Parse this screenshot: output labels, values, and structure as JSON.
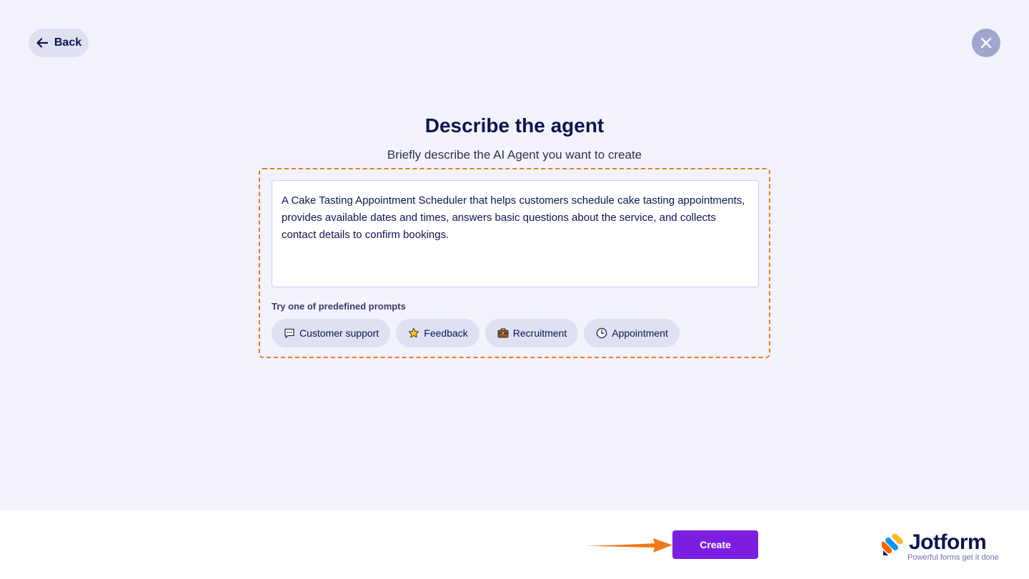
{
  "header": {
    "back_label": "Back",
    "back_icon": "arrow-left-icon",
    "close_icon": "close-icon"
  },
  "main": {
    "title": "Describe the agent",
    "subtitle": "Briefly describe the AI Agent you want to create",
    "description_value": "A Cake Tasting Appointment Scheduler that helps customers schedule cake tasting appointments, provides available dates and times, answers basic questions about the service, and collects contact details to confirm bookings.",
    "predefined_label": "Try one of predefined prompts",
    "chips": [
      {
        "label": "Customer support",
        "icon": "chat-bubble-icon"
      },
      {
        "label": "Feedback",
        "icon": "star-icon"
      },
      {
        "label": "Recruitment",
        "icon": "briefcase-icon"
      },
      {
        "label": "Appointment",
        "icon": "clock-icon"
      }
    ]
  },
  "footer": {
    "create_label": "Create",
    "logo_name": "Jotform",
    "logo_tagline": "Powerful forms get it done"
  },
  "colors": {
    "background": "#f3f3fd",
    "accent": "#7c1ee0",
    "highlight": "#f07a1a",
    "text": "#0a1551"
  }
}
